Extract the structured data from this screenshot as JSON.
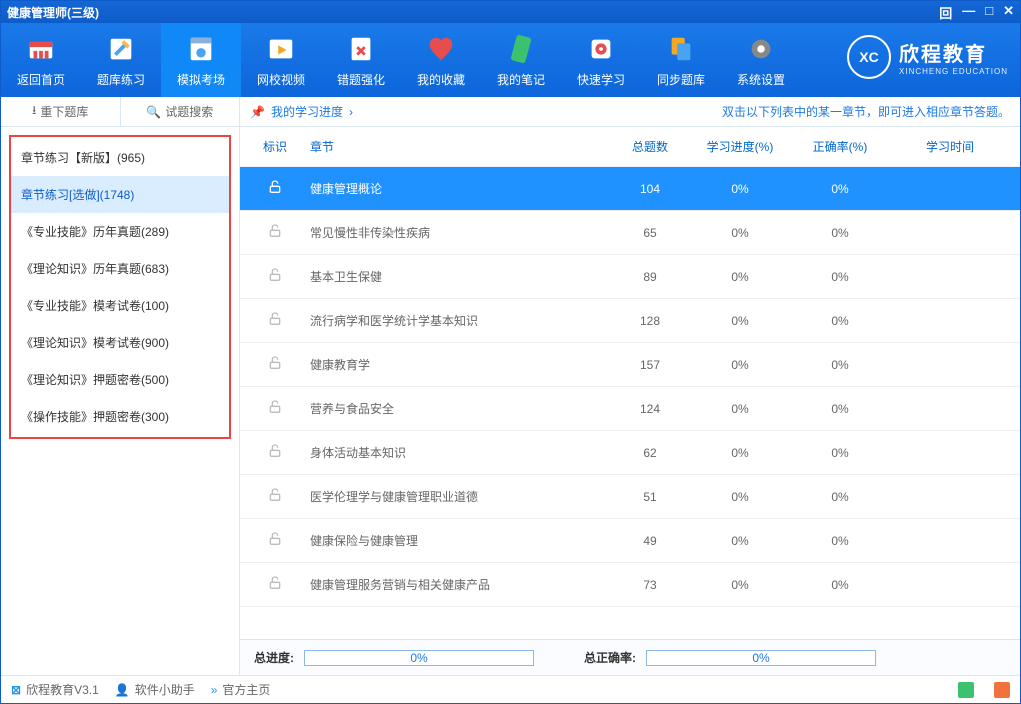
{
  "window": {
    "title": "健康管理师(三级)"
  },
  "toolbar": [
    {
      "id": "home",
      "label": "返回首页"
    },
    {
      "id": "bank",
      "label": "题库练习"
    },
    {
      "id": "sim",
      "label": "模拟考场"
    },
    {
      "id": "video",
      "label": "网校视频"
    },
    {
      "id": "wrong",
      "label": "错题强化"
    },
    {
      "id": "fav",
      "label": "我的收藏"
    },
    {
      "id": "notes",
      "label": "我的笔记"
    },
    {
      "id": "quick",
      "label": "快速学习"
    },
    {
      "id": "sync",
      "label": "同步题库"
    },
    {
      "id": "settings",
      "label": "系统设置"
    }
  ],
  "toolbar_active": 2,
  "brand": {
    "abbr": "XC",
    "cn": "欣程教育",
    "en": "XINCHENG EDUCATION"
  },
  "sidebar_head": {
    "redl": "重下题库",
    "search": "试题搜索"
  },
  "sidebar": [
    "章节练习【新版】(965)",
    "章节练习[选做](1748)",
    "《专业技能》历年真题(289)",
    "《理论知识》历年真题(683)",
    "《专业技能》模考试卷(100)",
    "《理论知识》模考试卷(900)",
    "《理论知识》押题密卷(500)",
    "《操作技能》押题密卷(300)"
  ],
  "sidebar_selected": 1,
  "main_head": {
    "left": "我的学习进度",
    "right": "双击以下列表中的某一章节，即可进入相应章节答题。"
  },
  "columns": {
    "lock": "标识",
    "chapter": "章节",
    "count": "总题数",
    "progress": "学习进度(%)",
    "accuracy": "正确率(%)",
    "time": "学习时间"
  },
  "rows": [
    {
      "name": "健康管理概论",
      "count": 104,
      "progress": "0%",
      "accuracy": "0%",
      "active": true
    },
    {
      "name": "常见慢性非传染性疾病",
      "count": 65,
      "progress": "0%",
      "accuracy": "0%"
    },
    {
      "name": "基本卫生保健",
      "count": 89,
      "progress": "0%",
      "accuracy": "0%"
    },
    {
      "name": "流行病学和医学统计学基本知识",
      "count": 128,
      "progress": "0%",
      "accuracy": "0%"
    },
    {
      "name": "健康教育学",
      "count": 157,
      "progress": "0%",
      "accuracy": "0%"
    },
    {
      "name": "营养与食品安全",
      "count": 124,
      "progress": "0%",
      "accuracy": "0%"
    },
    {
      "name": "身体活动基本知识",
      "count": 62,
      "progress": "0%",
      "accuracy": "0%"
    },
    {
      "name": "医学伦理学与健康管理职业道德",
      "count": 51,
      "progress": "0%",
      "accuracy": "0%"
    },
    {
      "name": "健康保险与健康管理",
      "count": 49,
      "progress": "0%",
      "accuracy": "0%"
    },
    {
      "name": "健康管理服务营销与相关健康产品",
      "count": 73,
      "progress": "0%",
      "accuracy": "0%"
    }
  ],
  "footer": {
    "total_prog_label": "总进度:",
    "total_prog": "0%",
    "total_acc_label": "总正确率:",
    "total_acc": "0%"
  },
  "status": {
    "app": "欣程教育V3.1",
    "helper": "软件小助手",
    "homepage": "官方主页"
  }
}
